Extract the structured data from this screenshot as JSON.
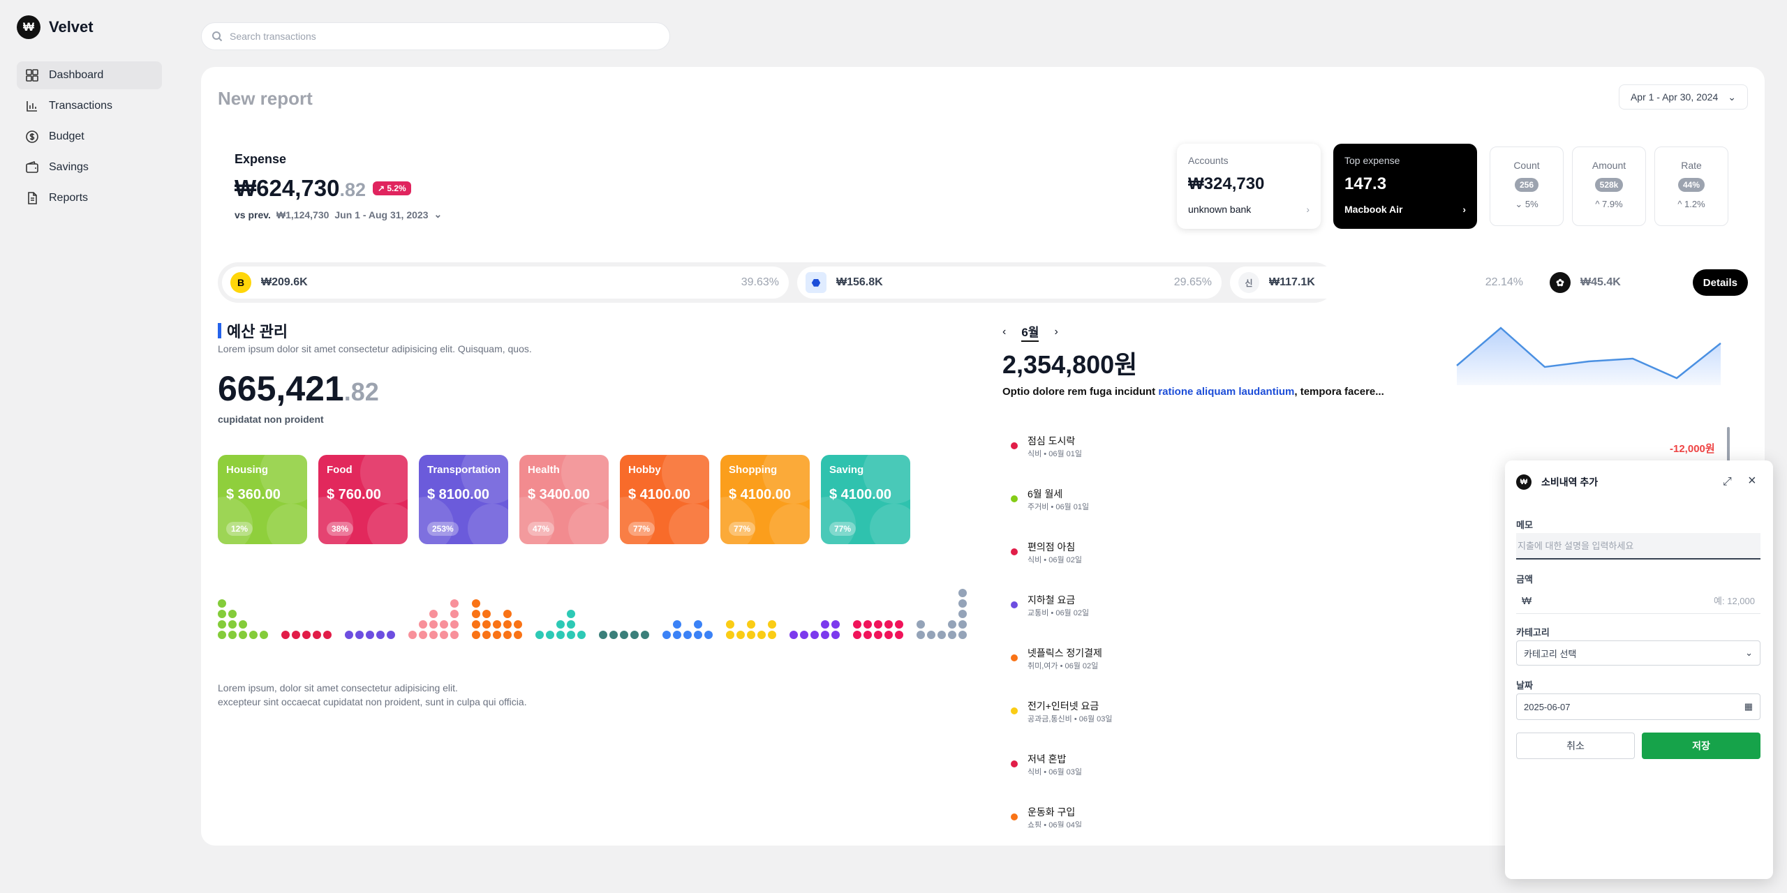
{
  "app": {
    "name": "Velvet",
    "logo_glyph": "₩"
  },
  "nav": [
    {
      "label": "Dashboard",
      "icon": "grid-icon",
      "active": true
    },
    {
      "label": "Transactions",
      "icon": "bar-chart-icon"
    },
    {
      "label": "Budget",
      "icon": "dollar-circle-icon"
    },
    {
      "label": "Savings",
      "icon": "wallet-icon"
    },
    {
      "label": "Reports",
      "icon": "document-icon"
    }
  ],
  "search": {
    "placeholder": "Search transactions"
  },
  "report": {
    "title": "New report",
    "date_range": "Apr 1 - Apr 30, 2024"
  },
  "expense": {
    "label": "Expense",
    "amount_main": "₩624,730",
    "amount_dec": ".82",
    "badge": "↗ 5.2%",
    "vs_label": "vs prev.",
    "vs_amount": "₩1,124,730",
    "vs_range": "Jun 1 - Aug 31, 2023"
  },
  "accounts_card": {
    "label": "Accounts",
    "value": "₩324,730",
    "sub": "unknown bank"
  },
  "top_expense_card": {
    "label": "Top expense",
    "value": "147.3",
    "sub": "Macbook Air"
  },
  "mini_stats": [
    {
      "label": "Count",
      "pill": "256",
      "change": "⌄ 5%"
    },
    {
      "label": "Amount",
      "pill": "528k",
      "change": "^ 7.9%"
    },
    {
      "label": "Rate",
      "pill": "44%",
      "change": "^ 1.2%"
    }
  ],
  "merchants": [
    {
      "icon": "B",
      "amount": "₩209.6K",
      "pct": "39.63%",
      "color": "#ffd60a",
      "fg": "#000"
    },
    {
      "icon": "bank-icon",
      "amount": "₩156.8K",
      "pct": "29.65%",
      "color": "#e0ecff",
      "fg": "#1d4ed8"
    },
    {
      "icon": "신",
      "amount": "₩117.1K",
      "pct": "22.14%",
      "color": "#f3f4f6",
      "fg": "#6b7280"
    },
    {
      "icon": "pig-icon",
      "amount": "₩45.4K",
      "pct": "",
      "color": "#111111",
      "fg": "#fff"
    }
  ],
  "details_button": "Details",
  "budget": {
    "title": "예산 관리",
    "desc": "Lorem ipsum dolor sit amet consectetur adipisicing elit. Quisquam, quos.",
    "big_main": "665,421",
    "big_dec": ".82",
    "big_sub": "cupidatat non proident"
  },
  "categories": [
    {
      "name": "Housing",
      "amount": "$ 360.00",
      "pct": "12%",
      "color": "#8fcf3c"
    },
    {
      "name": "Food",
      "amount": "$ 760.00",
      "pct": "38%",
      "color": "#e2285c"
    },
    {
      "name": "Transportation",
      "amount": "$ 8100.00",
      "pct": "253%",
      "color": "#6b5bdb"
    },
    {
      "name": "Health",
      "amount": "$ 3400.00",
      "pct": "47%",
      "color": "#f28b8f"
    },
    {
      "name": "Hobby",
      "amount": "$ 4100.00",
      "pct": "77%",
      "color": "#f86b2a"
    },
    {
      "name": "Shopping",
      "amount": "$ 4100.00",
      "pct": "77%",
      "color": "#fb9e1c"
    },
    {
      "name": "Saving",
      "amount": "$ 4100.00",
      "pct": "77%",
      "color": "#2fc2ae"
    }
  ],
  "dot_groups": [
    {
      "color": "#84cc3a",
      "cols": [
        4,
        3,
        2,
        1,
        1
      ]
    },
    {
      "color": "#e11d48",
      "cols": [
        1,
        1,
        1,
        1,
        1
      ]
    },
    {
      "color": "#6d4ee0",
      "cols": [
        1,
        1,
        1,
        1,
        1
      ]
    },
    {
      "color": "#f8909a",
      "cols": [
        1,
        2,
        3,
        2,
        4
      ]
    },
    {
      "color": "#f97316",
      "cols": [
        4,
        3,
        2,
        3,
        2
      ]
    },
    {
      "color": "#2dc9b5",
      "cols": [
        1,
        1,
        2,
        3,
        1
      ]
    },
    {
      "color": "#3b7f7a",
      "cols": [
        1,
        1,
        1,
        1,
        1
      ]
    },
    {
      "color": "#3b82f6",
      "cols": [
        1,
        2,
        1,
        2,
        1
      ]
    },
    {
      "color": "#facc15",
      "cols": [
        2,
        1,
        2,
        1,
        2
      ]
    },
    {
      "color": "#7c3aed",
      "cols": [
        1,
        1,
        1,
        2,
        2
      ]
    },
    {
      "color": "#f0145a",
      "cols": [
        2,
        2,
        2,
        2,
        2
      ]
    },
    {
      "color": "#94a3b8",
      "cols": [
        2,
        1,
        1,
        2,
        5
      ]
    }
  ],
  "footnote": [
    "Lorem ipsum, dolor sit amet consectetur adipisicing elit.",
    "excepteur sint occaecat cupidatat non proident, sunt in culpa qui officia."
  ],
  "month": {
    "label": "6월",
    "prev": "‹",
    "next": "›"
  },
  "total": "2,354,800원",
  "total_desc": {
    "pre": "Optio dolore rem fuga incidunt ",
    "highlight": "ratione aliquam laudantium",
    "post": ", tempora facere..."
  },
  "sparkline": [
    62,
    8,
    64,
    56,
    52,
    80,
    30
  ],
  "transactions": [
    {
      "name": "점심 도시락",
      "sub": "식비 • 06월 01일",
      "color": "#e11d48"
    },
    {
      "name": "6월 월세",
      "sub": "주거비 • 06월 01일",
      "color": "#84cc16"
    },
    {
      "name": "편의점 아침",
      "sub": "식비 • 06월 02일",
      "color": "#e11d48"
    },
    {
      "name": "지하철 요금",
      "sub": "교통비 • 06월 02일",
      "color": "#6d4ee0"
    },
    {
      "name": "넷플릭스 정기결제",
      "sub": "취미,여가 • 06월 02일",
      "color": "#f97316"
    },
    {
      "name": "전기+인터넷 요금",
      "sub": "공과금,통신비 • 06월 03일",
      "color": "#facc15"
    },
    {
      "name": "저녁 혼밥",
      "sub": "식비 • 06월 03일",
      "color": "#e11d48"
    },
    {
      "name": "운동화 구입",
      "sub": "쇼핑 • 06월 04일",
      "color": "#f97316"
    }
  ],
  "first_tx_amount": "-12,000원",
  "modal": {
    "title": "소비내역 추가",
    "memo_label": "메모",
    "memo_placeholder": "지출에 대한 설명을 입력하세요",
    "amount_label": "금액",
    "currency": "₩",
    "amount_placeholder": "예: 12,000",
    "category_label": "카테고리",
    "category_value": "카테고리 선택",
    "date_label": "날짜",
    "date_value": "2025-06-07",
    "cancel": "취소",
    "save": "저장"
  }
}
